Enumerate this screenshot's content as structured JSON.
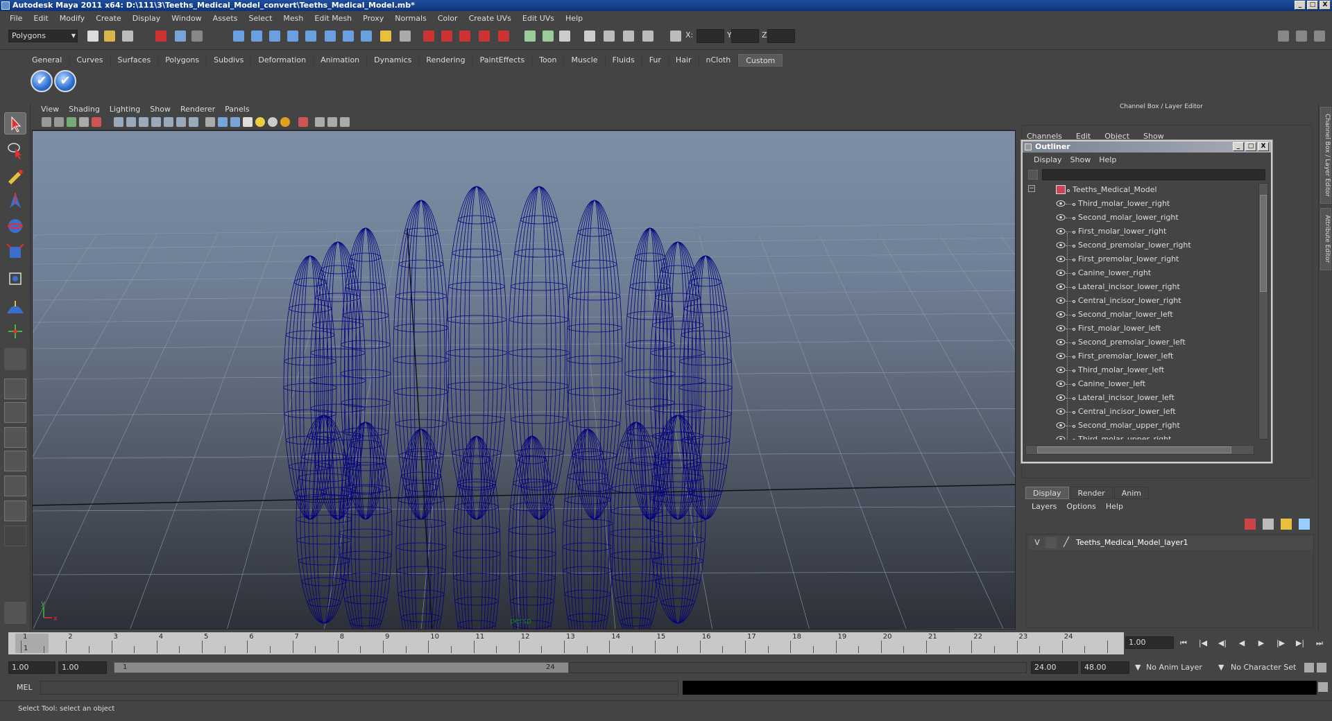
{
  "window": {
    "title": "Autodesk Maya 2011 x64: D:\\111\\3\\Teeths_Medical_Model_convert\\Teeths_Medical_Model.mb*",
    "controls": [
      "_",
      "□",
      "X"
    ]
  },
  "menubar": [
    "File",
    "Edit",
    "Modify",
    "Create",
    "Display",
    "Window",
    "Assets",
    "Select",
    "Mesh",
    "Edit Mesh",
    "Proxy",
    "Normals",
    "Color",
    "Create UVs",
    "Edit UVs",
    "Help"
  ],
  "statusline": {
    "mode": "Polygons",
    "x_label": "X:",
    "y_label": "Y:",
    "z_label": "Z:"
  },
  "shelf": {
    "tabs": [
      "General",
      "Curves",
      "Surfaces",
      "Polygons",
      "Subdivs",
      "Deformation",
      "Animation",
      "Dynamics",
      "Rendering",
      "PaintEffects",
      "Toon",
      "Muscle",
      "Fluids",
      "Fur",
      "Hair",
      "nCloth",
      "Custom"
    ],
    "active_tab": "Custom"
  },
  "viewport": {
    "menu": [
      "View",
      "Shading",
      "Lighting",
      "Show",
      "Renderer",
      "Panels"
    ],
    "camera": "persp",
    "axis_x": "x",
    "axis_y": "y",
    "wire_color": "#000080"
  },
  "channelbox": {
    "title": "Channel Box / Layer Editor",
    "menu": [
      "Channels",
      "Edit",
      "Object",
      "Show"
    ]
  },
  "side_tabs": [
    "Channel Box / Layer Editor",
    "Attribute Editor"
  ],
  "outliner": {
    "title": "Outliner",
    "menu": [
      "Display",
      "Show",
      "Help"
    ],
    "root": "Teeths_Medical_Model",
    "items": [
      "Third_molar_lower_right",
      "Second_molar_lower_right",
      "First_molar_lower_right",
      "Second_premolar_lower_right",
      "First_premolar_lower_right",
      "Canine_lower_right",
      "Lateral_incisor_lower_right",
      "Central_incisor_lower_right",
      "Second_molar_lower_left",
      "First_molar_lower_left",
      "Second_premolar_lower_left",
      "First_premolar_lower_left",
      "Third_molar_lower_left",
      "Canine_lower_left",
      "Lateral_incisor_lower_left",
      "Central_incisor_lower_left",
      "Second_molar_upper_right",
      "Third_molar_upper_right"
    ]
  },
  "layer_editor": {
    "tabs": [
      "Display",
      "Render",
      "Anim"
    ],
    "active_tab": "Display",
    "menu": [
      "Layers",
      "Options",
      "Help"
    ],
    "layer": {
      "visible": "V",
      "name": "Teeths_Medical_Model_layer1"
    }
  },
  "timeslider": {
    "ticks": [
      "1",
      "2",
      "3",
      "4",
      "5",
      "6",
      "7",
      "8",
      "9",
      "10",
      "11",
      "12",
      "13",
      "14",
      "15",
      "16",
      "17",
      "18",
      "19",
      "20",
      "21",
      "22",
      "23",
      "24"
    ],
    "current_marker": "1",
    "current_frame": "1.00"
  },
  "range": {
    "start_anim": "1.00",
    "start": "1.00",
    "bar_start": "1",
    "bar_end": "24",
    "end": "24.00",
    "end_anim": "48.00",
    "anim_layer": "No Anim Layer",
    "char_set": "No Character Set"
  },
  "cmdline": {
    "label": "MEL"
  },
  "helpline": {
    "text": "Select Tool: select an object"
  }
}
